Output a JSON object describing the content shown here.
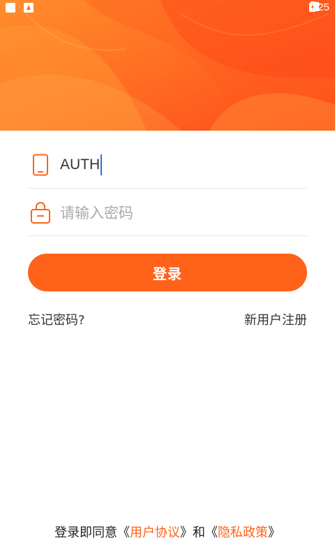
{
  "status_bar": {
    "time": "2:25",
    "icons": [
      "notification-square-icon",
      "app-a-icon",
      "wifi-icon",
      "signal-icon",
      "battery-icon"
    ]
  },
  "colors": {
    "accent": "#ff6219",
    "header_gradient_start": "#ff8a2b",
    "header_gradient_end": "#ff4f1c"
  },
  "form": {
    "account_icon": "phone-icon",
    "account_value": "AUTH",
    "password_icon": "lock-icon",
    "password_placeholder": "请输入密码",
    "login_label": "登录"
  },
  "links": {
    "forgot_password": "忘记密码?",
    "register": "新用户注册"
  },
  "agreement": {
    "prefix": "登录即同意",
    "bracket_open": "《",
    "user_agreement": "用户协议",
    "bracket_close": "》",
    "and": "和",
    "privacy_policy": "隐私政策"
  }
}
